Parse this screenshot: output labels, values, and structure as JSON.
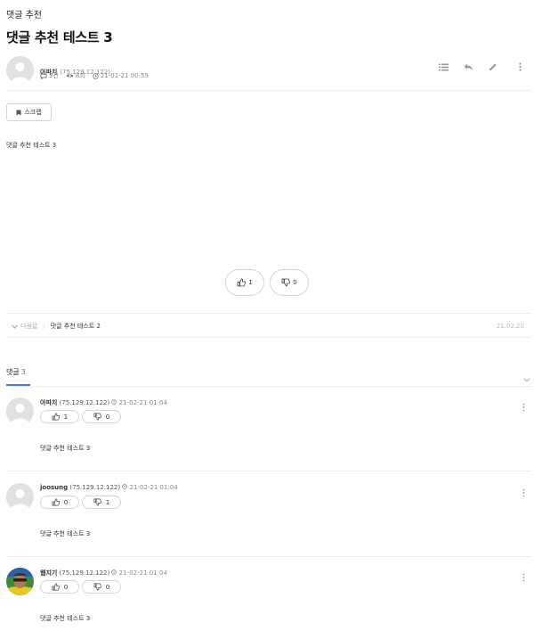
{
  "board_name": "댓글 추천",
  "post": {
    "title": "댓글 추천 테스트 3",
    "author": "아파치",
    "ip": "(75.129.12.122)",
    "comment_count": "3건",
    "views": "8회",
    "date": "21-02-21 00:59",
    "content": "댓글 추천 테스트 3"
  },
  "toolbar": {
    "list_icon": "list-icon",
    "reply_icon": "reply-icon",
    "edit_icon": "pencil-icon",
    "more_icon": "kebab-icon"
  },
  "scrap_label": "스크랩",
  "votes": {
    "good": "1",
    "bad": "0"
  },
  "next_post": {
    "label": "다음글",
    "title": "댓글 추천 테스트 2",
    "date": "21.02.20"
  },
  "comments_header": {
    "label": "댓글",
    "count": "3"
  },
  "comments": [
    {
      "author": "아파치",
      "ip": "(75.129.12.122)",
      "date": "21-02-21 01:04",
      "good": "1",
      "bad": "0",
      "text": "댓글 추천 테스트 3"
    },
    {
      "author": "joosung",
      "ip": "(75.129.12.122)",
      "date": "21-02-21 01:04",
      "good": "0",
      "bad": "1",
      "text": "댓글 추천 테스트 3"
    },
    {
      "author": "웹지기",
      "ip": "(75.129.12.122)",
      "date": "21-02-21 01:04",
      "good": "0",
      "bad": "0",
      "text": "댓글 추천 테스트 3"
    }
  ],
  "colors": {
    "accent": "#3b7dd8",
    "border": "#d6d6d6",
    "muted": "#888888"
  }
}
